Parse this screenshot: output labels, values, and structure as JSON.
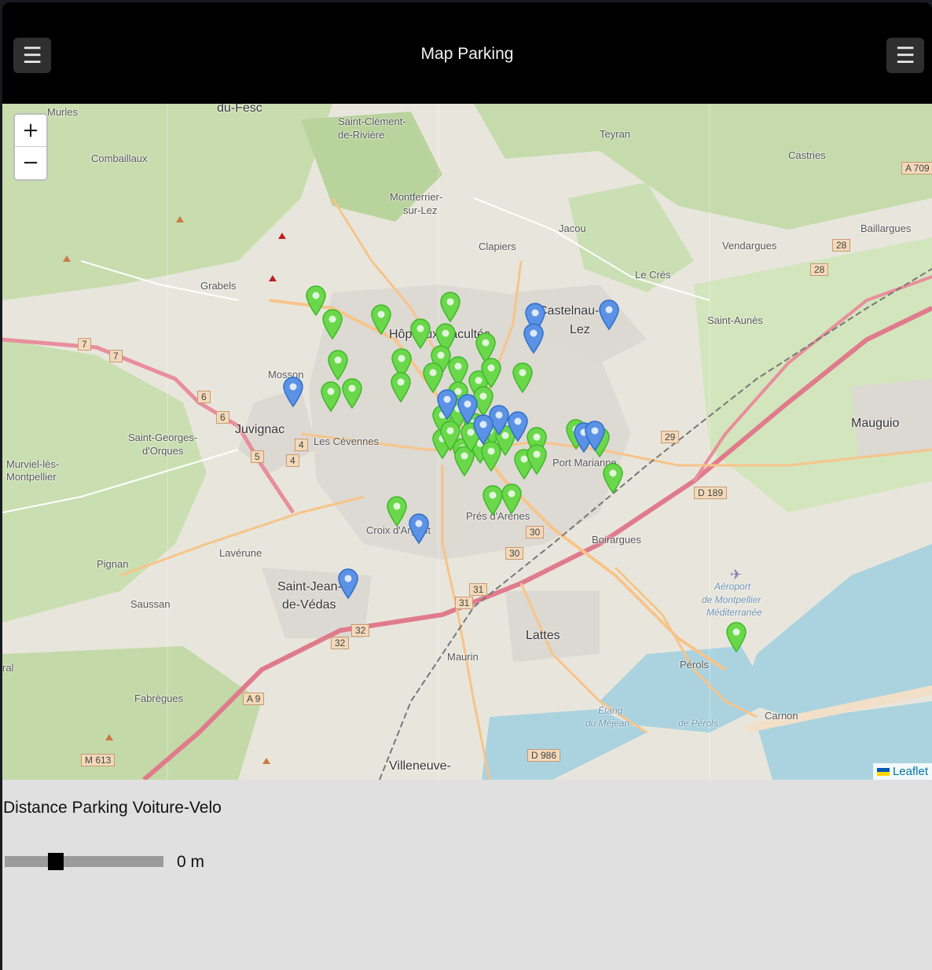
{
  "header": {
    "title": "Map Parking",
    "left_menu_glyph": "☰",
    "right_menu_glyph": "☰"
  },
  "map": {
    "zoom_in_label": "+",
    "zoom_out_label": "−",
    "attribution": "Leaflet",
    "places": [
      "Murles",
      "du-Fesc",
      "Saint-Clément-",
      "de-Rivière",
      "Teyran",
      "Castries",
      "Combaillaux",
      "Montferrier-",
      "sur-Lez",
      "Jacou",
      "Baillargues",
      "Clapiers",
      "Vendargues",
      "Grabels",
      "Le Crès",
      "Castelnau-le-",
      "Lez",
      "Saint-Aunès",
      "Hôpitaux-Facultés",
      "Mosson",
      "Juvignac",
      "Les Cévennes",
      "Mauguio",
      "Saint-Georges-",
      "d'Orques",
      "Murviel-lès-",
      "Montpellier",
      "Port Marianne",
      "Prés d'Arènes",
      "Croix d'Argent",
      "Boirargues",
      "Lavérune",
      "Pignan",
      "Saint-Jean-",
      "de-Védas",
      "Saussan",
      "Aéroport",
      "de Montpellier",
      "Méditerranée",
      "Lattes",
      "Maurin",
      "Pérols",
      "Fabrègues",
      "Carnon",
      "Étang",
      "du Méjean",
      "de Pérols",
      "Villeneuve-",
      "ral"
    ],
    "road_shields": [
      "A 709",
      "D 189",
      "A 9",
      "M 613",
      "D 986",
      "28",
      "28",
      "29",
      "30",
      "30",
      "31",
      "31",
      "32",
      "32",
      "7",
      "7",
      "6",
      "6",
      "5",
      "4",
      "4"
    ],
    "marker_colors": {
      "car": "#5b92e5",
      "bike": "#6ad84a"
    }
  },
  "controls": {
    "distance_label": "Distance Parking Voiture-Velo",
    "distance_value": "0 m",
    "slider_position": 0.3
  }
}
